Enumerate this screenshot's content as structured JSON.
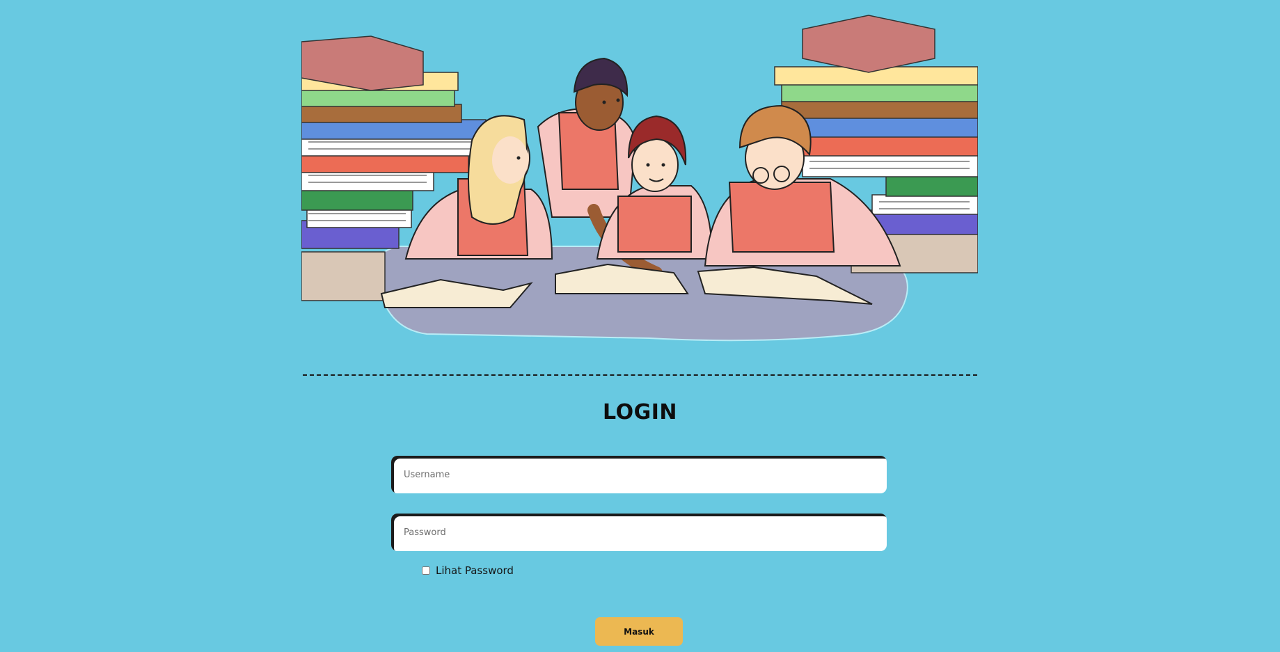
{
  "hero": {
    "illustration": "students-studying-with-books"
  },
  "login": {
    "title": "LOGIN",
    "username_placeholder": "Username",
    "username_value": "",
    "password_placeholder": "Password",
    "password_value": "",
    "show_password_label": "Lihat Password",
    "show_password_checked": false,
    "submit_label": "Masuk"
  },
  "colors": {
    "background": "#68c9e1",
    "button": "#ecb852",
    "input": "#ffffff",
    "text": "#0d0d0d"
  }
}
